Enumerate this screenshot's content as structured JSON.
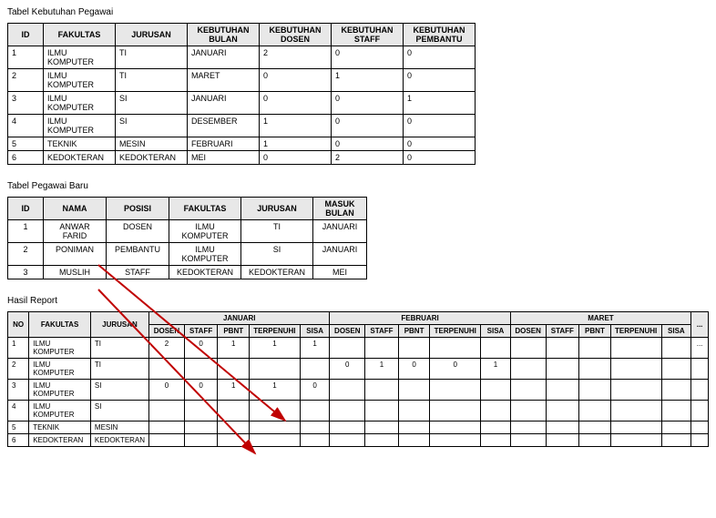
{
  "section1": {
    "title": "Tabel Kebutuhan Pegawai"
  },
  "section2": {
    "title": "Tabel Pegawai Baru"
  },
  "section3": {
    "title": "Hasil Report"
  },
  "t1": {
    "headers": [
      "ID",
      "FAKULTAS",
      "JURUSAN",
      "KEBUTUHAN BULAN",
      "KEBUTUHAN DOSEN",
      "KEBUTUHAN STAFF",
      "KEBUTUHAN PEMBANTU"
    ],
    "rows": [
      {
        "id": "1",
        "fak": "ILMU KOMPUTER",
        "jur": "TI",
        "bul": "JANUARI",
        "dos": "2",
        "stf": "0",
        "pbn": "0"
      },
      {
        "id": "2",
        "fak": "ILMU KOMPUTER",
        "jur": "TI",
        "bul": "MARET",
        "dos": "0",
        "stf": "1",
        "pbn": "0"
      },
      {
        "id": "3",
        "fak": "ILMU KOMPUTER",
        "jur": "SI",
        "bul": "JANUARI",
        "dos": "0",
        "stf": "0",
        "pbn": "1"
      },
      {
        "id": "4",
        "fak": "ILMU KOMPUTER",
        "jur": "SI",
        "bul": "DESEMBER",
        "dos": "1",
        "stf": "0",
        "pbn": "0"
      },
      {
        "id": "5",
        "fak": "TEKNIK",
        "jur": "MESIN",
        "bul": "FEBRUARI",
        "dos": "1",
        "stf": "0",
        "pbn": "0"
      },
      {
        "id": "6",
        "fak": "KEDOKTERAN",
        "jur": "KEDOKTERAN",
        "bul": "MEI",
        "dos": "0",
        "stf": "2",
        "pbn": "0"
      }
    ]
  },
  "t2": {
    "headers": [
      "ID",
      "NAMA",
      "POSISI",
      "FAKULTAS",
      "JURUSAN",
      "MASUK BULAN"
    ],
    "rows": [
      {
        "id": "1",
        "nama": "ANWAR FARID",
        "pos": "DOSEN",
        "fak": "ILMU KOMPUTER",
        "jur": "TI",
        "bul": "JANUARI"
      },
      {
        "id": "2",
        "nama": "PONIMAN",
        "pos": "PEMBANTU",
        "fak": "ILMU KOMPUTER",
        "jur": "SI",
        "bul": "JANUARI"
      },
      {
        "id": "3",
        "nama": "MUSLIH",
        "pos": "STAFF",
        "fak": "KEDOKTERAN",
        "jur": "KEDOKTERAN",
        "bul": "MEI"
      }
    ]
  },
  "t3": {
    "head_top": {
      "no": "NO",
      "fak": "FAKULTAS",
      "jur": "JURUSAN",
      "m1": "JANUARI",
      "m2": "FEBRUARI",
      "m3": "MARET",
      "ell": "..."
    },
    "head_sub": [
      "DOSEN",
      "STAFF",
      "PBNT",
      "TERPENUHI",
      "SISA"
    ],
    "rows": [
      {
        "no": "1",
        "fak": "ILMU KOMPUTER",
        "jur": "TI",
        "jan": {
          "d": "2",
          "s": "0",
          "p": "1",
          "t": "1",
          "r": "1"
        },
        "feb": {
          "d": "",
          "s": "",
          "p": "",
          "t": "",
          "r": ""
        },
        "mar": {
          "d": "",
          "s": "",
          "p": "",
          "t": "",
          "r": ""
        },
        "ell": "..."
      },
      {
        "no": "2",
        "fak": "ILMU KOMPUTER",
        "jur": "TI",
        "jan": {
          "d": "",
          "s": "",
          "p": "",
          "t": "",
          "r": ""
        },
        "feb": {
          "d": "0",
          "s": "1",
          "p": "0",
          "t": "0",
          "r": "1"
        },
        "mar": {
          "d": "",
          "s": "",
          "p": "",
          "t": "",
          "r": ""
        },
        "ell": ""
      },
      {
        "no": "3",
        "fak": "ILMU KOMPUTER",
        "jur": "SI",
        "jan": {
          "d": "0",
          "s": "0",
          "p": "1",
          "t": "1",
          "r": "0"
        },
        "feb": {
          "d": "",
          "s": "",
          "p": "",
          "t": "",
          "r": ""
        },
        "mar": {
          "d": "",
          "s": "",
          "p": "",
          "t": "",
          "r": ""
        },
        "ell": ""
      },
      {
        "no": "4",
        "fak": "ILMU KOMPUTER",
        "jur": "SI",
        "jan": {
          "d": "",
          "s": "",
          "p": "",
          "t": "",
          "r": ""
        },
        "feb": {
          "d": "",
          "s": "",
          "p": "",
          "t": "",
          "r": ""
        },
        "mar": {
          "d": "",
          "s": "",
          "p": "",
          "t": "",
          "r": ""
        },
        "ell": ""
      },
      {
        "no": "5",
        "fak": "TEKNIK",
        "jur": "MESIN",
        "jan": {
          "d": "",
          "s": "",
          "p": "",
          "t": "",
          "r": ""
        },
        "feb": {
          "d": "",
          "s": "",
          "p": "",
          "t": "",
          "r": ""
        },
        "mar": {
          "d": "",
          "s": "",
          "p": "",
          "t": "",
          "r": ""
        },
        "ell": ""
      },
      {
        "no": "6",
        "fak": "KEDOKTERAN",
        "jur": "KEDOKTERAN",
        "jan": {
          "d": "",
          "s": "",
          "p": "",
          "t": "",
          "r": ""
        },
        "feb": {
          "d": "",
          "s": "",
          "p": "",
          "t": "",
          "r": ""
        },
        "mar": {
          "d": "",
          "s": "",
          "p": "",
          "t": "",
          "r": ""
        },
        "ell": ""
      }
    ]
  }
}
